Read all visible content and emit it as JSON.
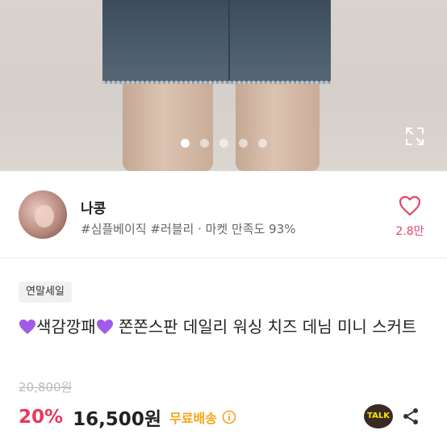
{
  "hero": {
    "carousel_dots": 5,
    "active_dot": 0
  },
  "seller": {
    "name": "나콩",
    "tags": "#심플베이직 #러블리 · 마켓 만족도 93%",
    "like_count": "2.8만"
  },
  "product": {
    "badge": "연말세일",
    "title_text": "색감깡패",
    "title_rest": " 쫀쫀스판 데일리 워싱 치즈 데님 미니 스커트",
    "original_price": "20,800원",
    "discount": "20%",
    "price": "16,500원",
    "shipping": "무료배송"
  },
  "actions": {
    "talk_label": "TALK"
  },
  "colors": {
    "accent": "#e8385c",
    "shipping": "#f6a417",
    "heart_emoji": "#a25be8"
  },
  "icons": [
    "expand-icon",
    "heart-outline-icon",
    "purple-heart-emoji-icon",
    "info-icon",
    "kakao-talk-icon",
    "share-icon"
  ]
}
